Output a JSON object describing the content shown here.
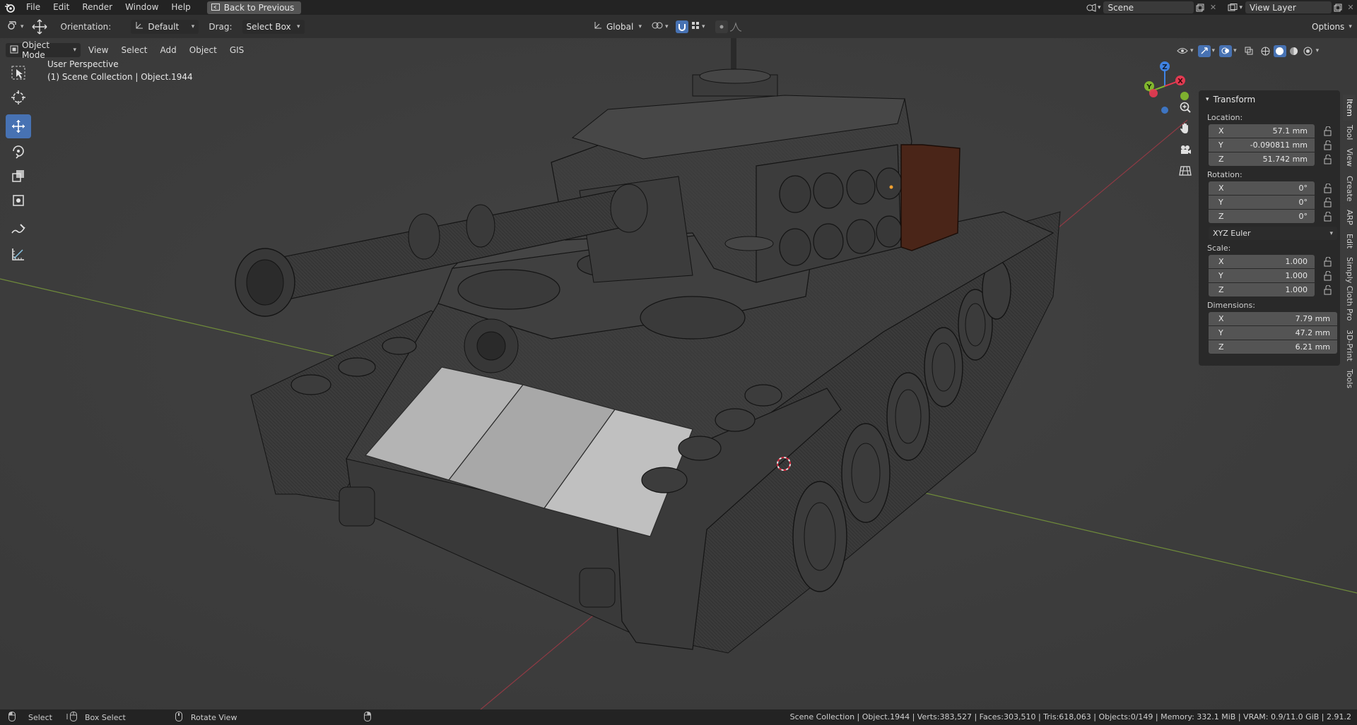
{
  "topbar": {
    "menus": [
      "File",
      "Edit",
      "Render",
      "Window",
      "Help"
    ],
    "back_button": "Back to Previous",
    "scene_name": "Scene",
    "view_layer": "View Layer"
  },
  "header": {
    "orientation_label": "Orientation:",
    "orientation_value": "Default",
    "drag_label": "Drag:",
    "drag_value": "Select Box",
    "transform_space": "Global",
    "options_label": "Options"
  },
  "viewport_header": {
    "mode": "Object Mode",
    "menus": [
      "View",
      "Select",
      "Add",
      "Object",
      "GIS"
    ]
  },
  "overlay": {
    "perspective": "User Perspective",
    "collection": "(1) Scene Collection | Object.1944"
  },
  "gizmo": {
    "axis_x": "X",
    "axis_y": "Y",
    "axis_z": "Z"
  },
  "npanel": {
    "section_title": "Transform",
    "location_label": "Location:",
    "location": [
      {
        "axis": "X",
        "value": "57.1 mm"
      },
      {
        "axis": "Y",
        "value": "-0.090811 mm"
      },
      {
        "axis": "Z",
        "value": "51.742 mm"
      }
    ],
    "rotation_label": "Rotation:",
    "rotation": [
      {
        "axis": "X",
        "value": "0°"
      },
      {
        "axis": "Y",
        "value": "0°"
      },
      {
        "axis": "Z",
        "value": "0°"
      }
    ],
    "rotation_mode": "XYZ Euler",
    "scale_label": "Scale:",
    "scale": [
      {
        "axis": "X",
        "value": "1.000"
      },
      {
        "axis": "Y",
        "value": "1.000"
      },
      {
        "axis": "Z",
        "value": "1.000"
      }
    ],
    "dimensions_label": "Dimensions:",
    "dimensions": [
      {
        "axis": "X",
        "value": "7.79 mm"
      },
      {
        "axis": "Y",
        "value": "47.2 mm"
      },
      {
        "axis": "Z",
        "value": "6.21 mm"
      }
    ],
    "tabs": [
      "Item",
      "Tool",
      "View",
      "Create",
      "ARP",
      "Edit",
      "Simply Cloth Pro",
      "3D-Print",
      "Tools"
    ]
  },
  "statusbar": {
    "select": "Select",
    "box_select": "Box Select",
    "rotate_view": "Rotate View",
    "stats": "Scene Collection | Object.1944 | Verts:383,527 | Faces:303,510 | Tris:618,063 | Objects:0/149 | Memory: 332.1 MiB | VRAM: 0.9/11.0 GiB | 2.91.2"
  },
  "colors": {
    "accent": "#4772b3",
    "viewport_bg": "#3d3d3d",
    "axis_x": "#e23a51",
    "axis_y": "#82b72e",
    "axis_z": "#3f83e3",
    "selected_part": "#4a2518"
  }
}
